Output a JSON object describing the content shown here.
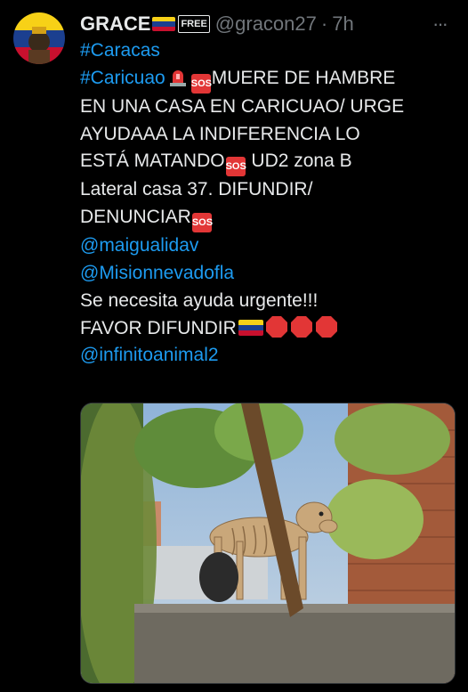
{
  "tweet": {
    "display_name": "GRACE",
    "free_badge": "FREE",
    "handle": "@gracon27",
    "separator": "·",
    "time": "7h",
    "more_label": "···",
    "lines": {
      "hashtag1": "#Caracas",
      "hashtag2": "#Caricuao",
      "l2_text": "MUERE DE HAMBRE",
      "l3": "EN UNA CASA EN CARICUAO/ URGE",
      "l4": "AYUDAAA LA INDIFERENCIA LO",
      "l5a": "ESTÁ MATANDO",
      "l5b": " UD2 zona B",
      "l6": "Lateral casa 37. DIFUNDIR/",
      "l7": "DENUNCIAR",
      "mention1": "@maigualidav",
      "mention2": "@Misionnevadofla",
      "l10": "Se necesita ayuda urgente!!!",
      "l11": "FAVOR DIFUNDIR",
      "mention3": "@infinitoanimal2"
    },
    "sos_label": "SOS"
  },
  "colors": {
    "background": "#000000",
    "text": "#e7e9ea",
    "secondary": "#71767b",
    "link": "#1d9bf0",
    "sos": "#e23636"
  },
  "icons": [
    "venezuela-flag-icon",
    "free-badge-icon",
    "siren-icon",
    "sos-icon",
    "stop-sign-icon",
    "more-icon"
  ]
}
